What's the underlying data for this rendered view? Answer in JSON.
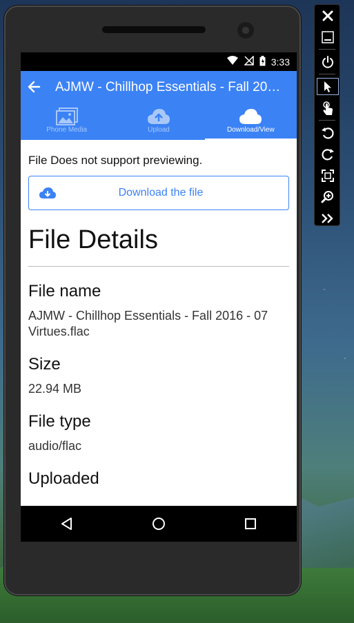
{
  "status_bar": {
    "time": "3:33"
  },
  "app_bar": {
    "title": "AJMW - Chillhop Essentials - Fall 2016 - 07 Virtues.flac",
    "tabs": [
      {
        "label": "Phone Media",
        "icon": "image-gallery-icon",
        "active": false
      },
      {
        "label": "Upload",
        "icon": "cloud-upload-icon",
        "active": false
      },
      {
        "label": "Download/View",
        "icon": "cloud-icon",
        "active": true
      }
    ]
  },
  "preview": {
    "message": "File Does not support previewing.",
    "download_label": "Download the file"
  },
  "details": {
    "heading": "File Details",
    "fields": [
      {
        "label": "File name",
        "value": "AJMW - Chillhop Essentials - Fall 2016 - 07 Virtues.flac"
      },
      {
        "label": "Size",
        "value": "22.94 MB"
      },
      {
        "label": "File type",
        "value": "audio/flac"
      },
      {
        "label": "Uploaded",
        "value": ""
      }
    ]
  },
  "nav_bar": {
    "buttons": [
      "back-icon",
      "home-icon",
      "recents-icon"
    ]
  },
  "emulator_toolbar": {
    "buttons": [
      "close-icon",
      "minimize-icon",
      "power-icon",
      "pointer-icon",
      "touch-icon",
      "rotate-left-icon",
      "rotate-right-icon",
      "fit-screen-icon",
      "zoom-icon",
      "more-icon"
    ]
  },
  "colors": {
    "accent": "#3b82f5",
    "tab_inactive": "#a9c8fa"
  }
}
